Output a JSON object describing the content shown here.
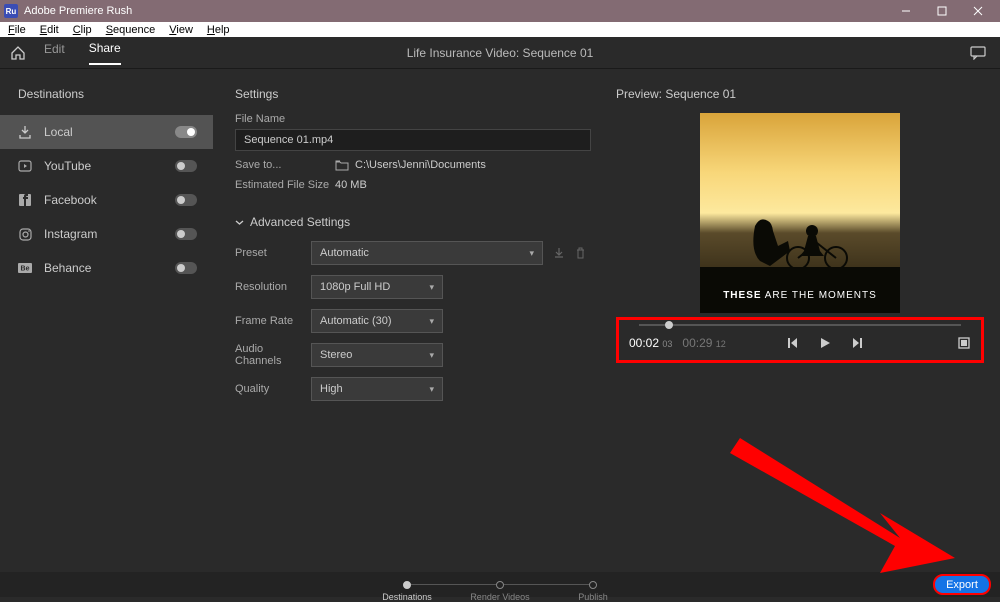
{
  "titlebar": {
    "app_name": "Adobe Premiere Rush"
  },
  "menubar": [
    "File",
    "Edit",
    "Clip",
    "Sequence",
    "View",
    "Help"
  ],
  "topbar": {
    "tabs": [
      {
        "label": "Edit",
        "active": false
      },
      {
        "label": "Share",
        "active": true
      }
    ],
    "breadcrumb": "Life Insurance Video: Sequence 01"
  },
  "sidebar": {
    "title": "Destinations",
    "items": [
      {
        "label": "Local",
        "icon": "export-icon",
        "active": true,
        "toggled": true
      },
      {
        "label": "YouTube",
        "icon": "play-rect-icon",
        "active": false,
        "toggled": false
      },
      {
        "label": "Facebook",
        "icon": "facebook-icon",
        "active": false,
        "toggled": false
      },
      {
        "label": "Instagram",
        "icon": "instagram-icon",
        "active": false,
        "toggled": false
      },
      {
        "label": "Behance",
        "icon": "behance-icon",
        "active": false,
        "toggled": false
      }
    ]
  },
  "settings": {
    "title": "Settings",
    "file_name_label": "File Name",
    "file_name_value": "Sequence 01.mp4",
    "save_to_label": "Save to...",
    "save_to_value": "C:\\Users\\Jenni\\Documents",
    "est_size_label": "Estimated File Size",
    "est_size_value": "40 MB",
    "advanced": {
      "title": "Advanced Settings",
      "preset_label": "Preset",
      "preset_value": "Automatic",
      "resolution_label": "Resolution",
      "resolution_value": "1080p Full HD",
      "framerate_label": "Frame Rate",
      "framerate_value": "Automatic (30)",
      "audio_label": "Audio Channels",
      "audio_value": "Stereo",
      "quality_label": "Quality",
      "quality_value": "High"
    }
  },
  "preview": {
    "title": "Preview: Sequence 01",
    "overlay_bold": "THESE",
    "overlay_rest": " ARE THE MOMENTS",
    "time_current": "00:02",
    "time_current_frames": "03",
    "time_total": "00:29",
    "time_total_frames": "12"
  },
  "steps": [
    {
      "label": "Destinations",
      "active": true
    },
    {
      "label": "Render Videos",
      "active": false
    },
    {
      "label": "Publish",
      "active": false
    }
  ],
  "export_label": "Export"
}
